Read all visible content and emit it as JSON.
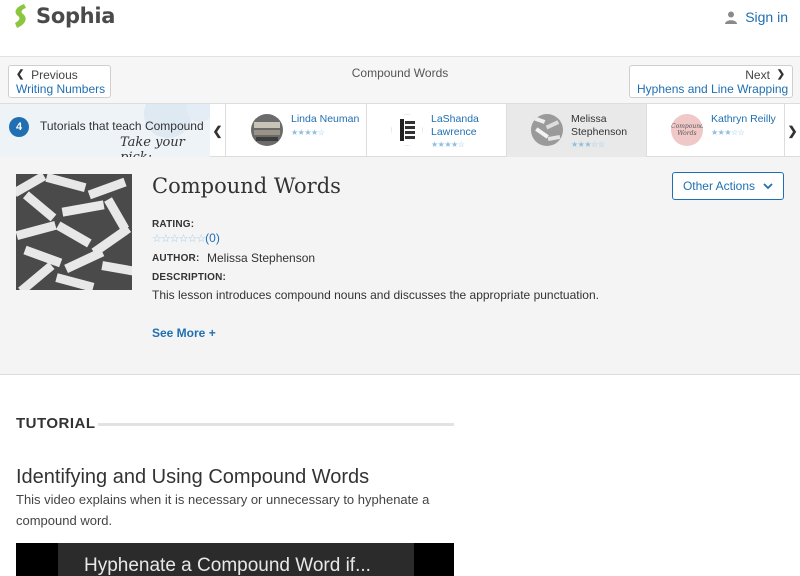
{
  "brand": {
    "name": "Sophia",
    "accent": "#8cc63f"
  },
  "header": {
    "signin_label": "Sign in",
    "signin_icon": "user-icon"
  },
  "lesson_nav": {
    "prev": {
      "label": "Previous",
      "title": "Writing Numbers"
    },
    "current_title": "Compound Words",
    "next": {
      "label": "Next",
      "title": "Hyphens and Line Wrapping"
    }
  },
  "tutor_strip": {
    "count": "4",
    "text": "Tutorials that teach Compound",
    "script": "Take your pick:",
    "tutors": [
      {
        "name": "Linda Neuman",
        "stars": "★★★★☆",
        "active": false
      },
      {
        "name": "LaShanda Lawrence",
        "stars": "★★★★☆",
        "active": false
      },
      {
        "name": "Melissa Stephenson",
        "stars": "★★★☆☆",
        "active": true
      },
      {
        "name": "Kathryn Reilly",
        "stars": "★★★☆☆",
        "active": false
      }
    ],
    "kathryn_avatar_text": "Compound Words"
  },
  "lesson": {
    "title": "Compound Words",
    "actions_label": "Other Actions",
    "rating_label": "RATING:",
    "rating_stars": "☆☆☆☆☆☆",
    "rating_count": "(0)",
    "author_label": "AUTHOR:",
    "author": "Melissa Stephenson",
    "description_label": "DESCRIPTION:",
    "description": "This lesson introduces compound nouns and discusses the appropriate punctuation.",
    "see_more": "See More +"
  },
  "tutorial": {
    "section_label": "TUTORIAL",
    "title": "Identifying and Using Compound Words",
    "description": "This video explains when it is necessary or unnecessary to hyphenate a compound word.",
    "video_text": "Hyphenate a Compound Word if..."
  }
}
